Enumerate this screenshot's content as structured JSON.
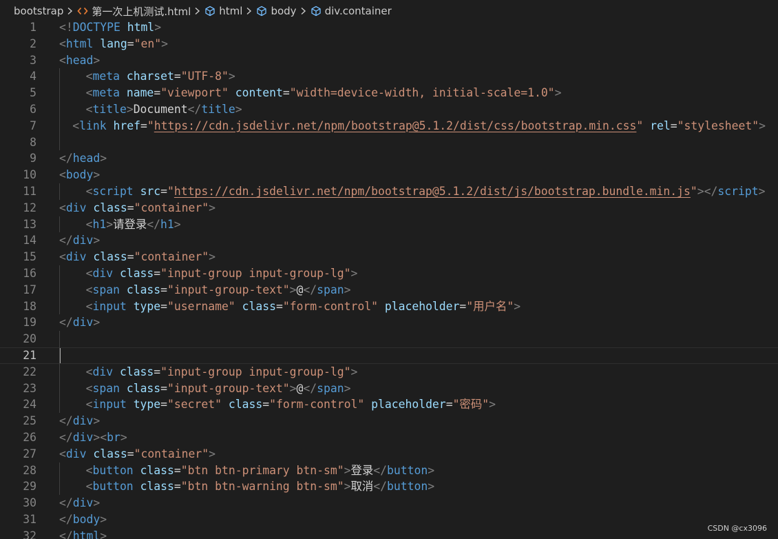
{
  "breadcrumb": {
    "items": [
      {
        "label": "bootstrap",
        "icon": null
      },
      {
        "label": "第一次上机测试.html",
        "icon": "html-file-icon"
      },
      {
        "label": "html",
        "icon": "element-cube-icon"
      },
      {
        "label": "body",
        "icon": "element-cube-icon"
      },
      {
        "label": "div.container",
        "icon": "element-cube-icon"
      }
    ]
  },
  "editor": {
    "current_line": 21,
    "lines": [
      {
        "n": "1",
        "indent": 0,
        "tokens": [
          [
            "punc",
            "<!"
          ],
          [
            "tag",
            "DOCTYPE"
          ],
          [
            "txt",
            " "
          ],
          [
            "attr",
            "html"
          ],
          [
            "punc",
            ">"
          ]
        ]
      },
      {
        "n": "2",
        "indent": 0,
        "tokens": [
          [
            "punc",
            "<"
          ],
          [
            "tag",
            "html"
          ],
          [
            "txt",
            " "
          ],
          [
            "attr",
            "lang"
          ],
          [
            "txt",
            "="
          ],
          [
            "str",
            "\"en\""
          ],
          [
            "punc",
            ">"
          ]
        ]
      },
      {
        "n": "3",
        "indent": 0,
        "tokens": [
          [
            "punc",
            "<"
          ],
          [
            "tag",
            "head"
          ],
          [
            "punc",
            ">"
          ]
        ]
      },
      {
        "n": "4",
        "indent": 4,
        "tokens": [
          [
            "punc",
            "<"
          ],
          [
            "tag",
            "meta"
          ],
          [
            "txt",
            " "
          ],
          [
            "attr",
            "charset"
          ],
          [
            "txt",
            "="
          ],
          [
            "str",
            "\"UTF-8\""
          ],
          [
            "punc",
            ">"
          ]
        ]
      },
      {
        "n": "5",
        "indent": 4,
        "tokens": [
          [
            "punc",
            "<"
          ],
          [
            "tag",
            "meta"
          ],
          [
            "txt",
            " "
          ],
          [
            "attr",
            "name"
          ],
          [
            "txt",
            "="
          ],
          [
            "str",
            "\"viewport\""
          ],
          [
            "txt",
            " "
          ],
          [
            "attr",
            "content"
          ],
          [
            "txt",
            "="
          ],
          [
            "str",
            "\"width=device-width, initial-scale=1.0\""
          ],
          [
            "punc",
            ">"
          ]
        ]
      },
      {
        "n": "6",
        "indent": 4,
        "tokens": [
          [
            "punc",
            "<"
          ],
          [
            "tag",
            "title"
          ],
          [
            "punc",
            ">"
          ],
          [
            "txt",
            "Document"
          ],
          [
            "punc",
            "</"
          ],
          [
            "tag",
            "title"
          ],
          [
            "punc",
            ">"
          ]
        ]
      },
      {
        "n": "7",
        "indent": 2,
        "tokens": [
          [
            "punc",
            "<"
          ],
          [
            "tag",
            "link"
          ],
          [
            "txt",
            " "
          ],
          [
            "attr",
            "href"
          ],
          [
            "txt",
            "="
          ],
          [
            "str",
            "\""
          ],
          [
            "url",
            "https://cdn.jsdelivr.net/npm/bootstrap@5.1.2/dist/css/bootstrap.min.css"
          ],
          [
            "str",
            "\""
          ],
          [
            "txt",
            " "
          ],
          [
            "attr",
            "rel"
          ],
          [
            "txt",
            "="
          ],
          [
            "str",
            "\"stylesheet\""
          ],
          [
            "punc",
            ">"
          ]
        ]
      },
      {
        "n": "8",
        "indent": 0,
        "tokens": []
      },
      {
        "n": "9",
        "indent": 0,
        "tokens": [
          [
            "punc",
            "</"
          ],
          [
            "tag",
            "head"
          ],
          [
            "punc",
            ">"
          ]
        ]
      },
      {
        "n": "10",
        "indent": 0,
        "tokens": [
          [
            "punc",
            "<"
          ],
          [
            "tag",
            "body"
          ],
          [
            "punc",
            ">"
          ]
        ]
      },
      {
        "n": "11",
        "indent": 4,
        "tokens": [
          [
            "punc",
            "<"
          ],
          [
            "tag",
            "script"
          ],
          [
            "txt",
            " "
          ],
          [
            "attr",
            "src"
          ],
          [
            "txt",
            "="
          ],
          [
            "str",
            "\""
          ],
          [
            "url",
            "https://cdn.jsdelivr.net/npm/bootstrap@5.1.2/dist/js/bootstrap.bundle.min.js"
          ],
          [
            "str",
            "\""
          ],
          [
            "punc",
            "></"
          ],
          [
            "tag",
            "script"
          ],
          [
            "punc",
            ">"
          ]
        ]
      },
      {
        "n": "12",
        "indent": 0,
        "tokens": [
          [
            "punc",
            "<"
          ],
          [
            "tag",
            "div"
          ],
          [
            "txt",
            " "
          ],
          [
            "attr",
            "class"
          ],
          [
            "txt",
            "="
          ],
          [
            "str",
            "\"container\""
          ],
          [
            "punc",
            ">"
          ]
        ]
      },
      {
        "n": "13",
        "indent": 4,
        "tokens": [
          [
            "punc",
            "<"
          ],
          [
            "tag",
            "h1"
          ],
          [
            "punc",
            ">"
          ],
          [
            "txt",
            "请登录"
          ],
          [
            "punc",
            "</"
          ],
          [
            "tag",
            "h1"
          ],
          [
            "punc",
            ">"
          ]
        ]
      },
      {
        "n": "14",
        "indent": 0,
        "tokens": [
          [
            "punc",
            "</"
          ],
          [
            "tag",
            "div"
          ],
          [
            "punc",
            ">"
          ]
        ]
      },
      {
        "n": "15",
        "indent": 0,
        "tokens": [
          [
            "punc",
            "<"
          ],
          [
            "tag",
            "div"
          ],
          [
            "txt",
            " "
          ],
          [
            "attr",
            "class"
          ],
          [
            "txt",
            "="
          ],
          [
            "str",
            "\"container\""
          ],
          [
            "punc",
            ">"
          ]
        ]
      },
      {
        "n": "16",
        "indent": 4,
        "tokens": [
          [
            "punc",
            "<"
          ],
          [
            "tag",
            "div"
          ],
          [
            "txt",
            " "
          ],
          [
            "attr",
            "class"
          ],
          [
            "txt",
            "="
          ],
          [
            "str",
            "\"input-group input-group-lg\""
          ],
          [
            "punc",
            ">"
          ]
        ]
      },
      {
        "n": "17",
        "indent": 4,
        "tokens": [
          [
            "punc",
            "<"
          ],
          [
            "tag",
            "span"
          ],
          [
            "txt",
            " "
          ],
          [
            "attr",
            "class"
          ],
          [
            "txt",
            "="
          ],
          [
            "str",
            "\"input-group-text\""
          ],
          [
            "punc",
            ">"
          ],
          [
            "txt",
            "@"
          ],
          [
            "punc",
            "</"
          ],
          [
            "tag",
            "span"
          ],
          [
            "punc",
            ">"
          ]
        ]
      },
      {
        "n": "18",
        "indent": 4,
        "tokens": [
          [
            "punc",
            "<"
          ],
          [
            "tag",
            "input"
          ],
          [
            "txt",
            " "
          ],
          [
            "attr",
            "type"
          ],
          [
            "txt",
            "="
          ],
          [
            "str",
            "\"username\""
          ],
          [
            "txt",
            " "
          ],
          [
            "attr",
            "class"
          ],
          [
            "txt",
            "="
          ],
          [
            "str",
            "\"form-control\""
          ],
          [
            "txt",
            " "
          ],
          [
            "attr",
            "placeholder"
          ],
          [
            "txt",
            "="
          ],
          [
            "str",
            "\"用户名\""
          ],
          [
            "punc",
            ">"
          ]
        ]
      },
      {
        "n": "19",
        "indent": 0,
        "tokens": [
          [
            "punc",
            "</"
          ],
          [
            "tag",
            "div"
          ],
          [
            "punc",
            ">"
          ]
        ]
      },
      {
        "n": "20",
        "indent": 0,
        "tokens": []
      },
      {
        "n": "21",
        "indent": 0,
        "tokens": []
      },
      {
        "n": "22",
        "indent": 4,
        "tokens": [
          [
            "punc",
            "<"
          ],
          [
            "tag",
            "div"
          ],
          [
            "txt",
            " "
          ],
          [
            "attr",
            "class"
          ],
          [
            "txt",
            "="
          ],
          [
            "str",
            "\"input-group input-group-lg\""
          ],
          [
            "punc",
            ">"
          ]
        ]
      },
      {
        "n": "23",
        "indent": 4,
        "tokens": [
          [
            "punc",
            "<"
          ],
          [
            "tag",
            "span"
          ],
          [
            "txt",
            " "
          ],
          [
            "attr",
            "class"
          ],
          [
            "txt",
            "="
          ],
          [
            "str",
            "\"input-group-text\""
          ],
          [
            "punc",
            ">"
          ],
          [
            "txt",
            "@"
          ],
          [
            "punc",
            "</"
          ],
          [
            "tag",
            "span"
          ],
          [
            "punc",
            ">"
          ]
        ]
      },
      {
        "n": "24",
        "indent": 4,
        "tokens": [
          [
            "punc",
            "<"
          ],
          [
            "tag",
            "input"
          ],
          [
            "txt",
            " "
          ],
          [
            "attr",
            "type"
          ],
          [
            "txt",
            "="
          ],
          [
            "str",
            "\"secret\""
          ],
          [
            "txt",
            " "
          ],
          [
            "attr",
            "class"
          ],
          [
            "txt",
            "="
          ],
          [
            "str",
            "\"form-control\""
          ],
          [
            "txt",
            " "
          ],
          [
            "attr",
            "placeholder"
          ],
          [
            "txt",
            "="
          ],
          [
            "str",
            "\"密码\""
          ],
          [
            "punc",
            ">"
          ]
        ]
      },
      {
        "n": "25",
        "indent": 0,
        "tokens": [
          [
            "punc",
            "</"
          ],
          [
            "tag",
            "div"
          ],
          [
            "punc",
            ">"
          ]
        ]
      },
      {
        "n": "26",
        "indent": 0,
        "tokens": [
          [
            "punc",
            "</"
          ],
          [
            "tag",
            "div"
          ],
          [
            "punc",
            "><"
          ],
          [
            "tag",
            "br"
          ],
          [
            "punc",
            ">"
          ]
        ]
      },
      {
        "n": "27",
        "indent": 0,
        "tokens": [
          [
            "punc",
            "<"
          ],
          [
            "tag",
            "div"
          ],
          [
            "txt",
            " "
          ],
          [
            "attr",
            "class"
          ],
          [
            "txt",
            "="
          ],
          [
            "str",
            "\"container\""
          ],
          [
            "punc",
            ">"
          ]
        ]
      },
      {
        "n": "28",
        "indent": 4,
        "tokens": [
          [
            "punc",
            "<"
          ],
          [
            "tag",
            "button"
          ],
          [
            "txt",
            " "
          ],
          [
            "attr",
            "class"
          ],
          [
            "txt",
            "="
          ],
          [
            "str",
            "\"btn btn-primary btn-sm\""
          ],
          [
            "punc",
            ">"
          ],
          [
            "txt",
            "登录"
          ],
          [
            "punc",
            "</"
          ],
          [
            "tag",
            "button"
          ],
          [
            "punc",
            ">"
          ]
        ]
      },
      {
        "n": "29",
        "indent": 4,
        "tokens": [
          [
            "punc",
            "<"
          ],
          [
            "tag",
            "button"
          ],
          [
            "txt",
            " "
          ],
          [
            "attr",
            "class"
          ],
          [
            "txt",
            "="
          ],
          [
            "str",
            "\"btn btn-warning btn-sm\""
          ],
          [
            "punc",
            ">"
          ],
          [
            "txt",
            "取消"
          ],
          [
            "punc",
            "</"
          ],
          [
            "tag",
            "button"
          ],
          [
            "punc",
            ">"
          ]
        ]
      },
      {
        "n": "30",
        "indent": 0,
        "tokens": [
          [
            "punc",
            "</"
          ],
          [
            "tag",
            "div"
          ],
          [
            "punc",
            ">"
          ]
        ]
      },
      {
        "n": "31",
        "indent": 0,
        "tokens": [
          [
            "punc",
            "</"
          ],
          [
            "tag",
            "body"
          ],
          [
            "punc",
            ">"
          ]
        ]
      },
      {
        "n": "32",
        "indent": 0,
        "tokens": [
          [
            "punc",
            "</"
          ],
          [
            "tag",
            "html"
          ],
          [
            "punc",
            ">"
          ]
        ]
      }
    ]
  },
  "watermark": "CSDN @cx3096",
  "colors": {
    "background": "#1e1e1e",
    "tag": "#569cd6",
    "attribute": "#9cdcfe",
    "string": "#ce9178",
    "punctuation": "#808080",
    "text": "#d4d4d4",
    "line_number": "#858585",
    "html_icon": "#e37933",
    "element_icon": "#75beff"
  }
}
